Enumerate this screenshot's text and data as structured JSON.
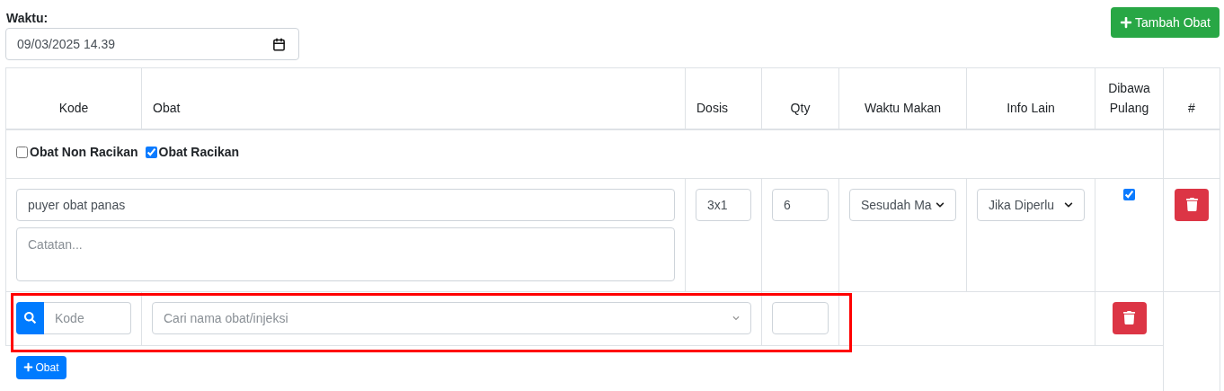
{
  "waktu": {
    "label": "Waktu:",
    "value": "09/03/2025 14.39"
  },
  "add_button": {
    "label": "Tambah Obat"
  },
  "table": {
    "columns": [
      "Kode",
      "Obat",
      "Dosis",
      "Qty",
      "Waktu Makan",
      "Info Lain",
      "Dibawa Pulang",
      "#"
    ],
    "type_options": [
      {
        "label": "Obat Non Racikan",
        "checked": false
      },
      {
        "label": "Obat Racikan",
        "checked": true
      }
    ],
    "item": {
      "name": "puyer obat panas",
      "note_placeholder": "Catatan...",
      "dosis": "3x1",
      "qty": "6",
      "waktu_makan": "Sesudah Ma",
      "info_lain": "Jika Diperlu",
      "dibawa_pulang": true
    },
    "ingredient": {
      "kode_placeholder": "Kode",
      "obat_placeholder": "Cari nama obat/injeksi",
      "highlighted": true
    },
    "add_ingredient_button": {
      "label": "Obat"
    }
  }
}
